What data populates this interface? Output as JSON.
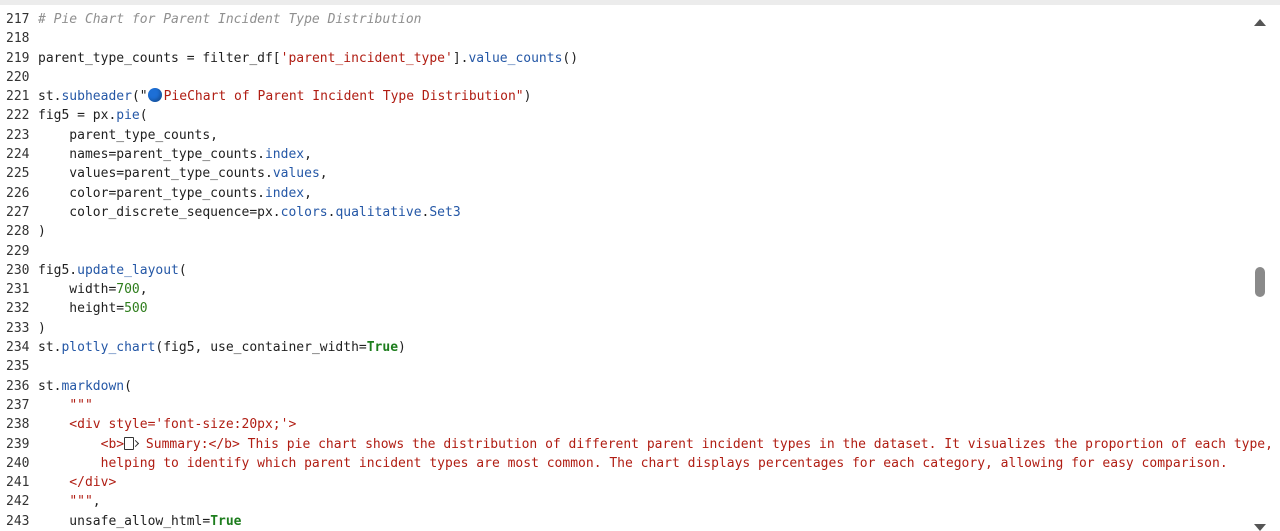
{
  "editor": {
    "lines": [
      {
        "n": "217",
        "parts": [
          {
            "t": "# Pie Chart for Parent Incident Type Distribution",
            "c": "comment"
          }
        ]
      },
      {
        "n": "218",
        "parts": []
      },
      {
        "n": "219",
        "parts": [
          {
            "t": "parent_type_counts = filter_df[",
            "c": ""
          },
          {
            "t": "'parent_incident_type'",
            "c": "str"
          },
          {
            "t": "].",
            "c": ""
          },
          {
            "t": "value_counts",
            "c": "attr"
          },
          {
            "t": "()",
            "c": ""
          }
        ]
      },
      {
        "n": "220",
        "parts": []
      },
      {
        "n": "221",
        "parts": [
          {
            "t": "st.",
            "c": ""
          },
          {
            "t": "subheader",
            "c": "attr"
          },
          {
            "t": "(\"",
            "c": ""
          },
          {
            "t": "",
            "c": "bluedot"
          },
          {
            "t": "PieChart of Parent Incident Type Distribution\"",
            "c": "str"
          },
          {
            "t": ")",
            "c": ""
          }
        ]
      },
      {
        "n": "222",
        "parts": [
          {
            "t": "fig5 = px.",
            "c": ""
          },
          {
            "t": "pie",
            "c": "attr"
          },
          {
            "t": "(",
            "c": ""
          }
        ]
      },
      {
        "n": "223",
        "parts": [
          {
            "t": "    parent_type_counts,",
            "c": ""
          }
        ]
      },
      {
        "n": "224",
        "parts": [
          {
            "t": "    names=parent_type_counts.",
            "c": ""
          },
          {
            "t": "index",
            "c": "attr"
          },
          {
            "t": ",",
            "c": ""
          }
        ]
      },
      {
        "n": "225",
        "parts": [
          {
            "t": "    values=parent_type_counts.",
            "c": ""
          },
          {
            "t": "values",
            "c": "attr"
          },
          {
            "t": ",",
            "c": ""
          }
        ]
      },
      {
        "n": "226",
        "parts": [
          {
            "t": "    color=parent_type_counts.",
            "c": ""
          },
          {
            "t": "index",
            "c": "attr"
          },
          {
            "t": ",",
            "c": ""
          }
        ]
      },
      {
        "n": "227",
        "parts": [
          {
            "t": "    color_discrete_sequence=px.",
            "c": ""
          },
          {
            "t": "colors",
            "c": "attr"
          },
          {
            "t": ".",
            "c": ""
          },
          {
            "t": "qualitative",
            "c": "attr"
          },
          {
            "t": ".",
            "c": ""
          },
          {
            "t": "Set3",
            "c": "attr"
          }
        ]
      },
      {
        "n": "228",
        "parts": [
          {
            "t": ")",
            "c": ""
          }
        ]
      },
      {
        "n": "229",
        "parts": []
      },
      {
        "n": "230",
        "parts": [
          {
            "t": "fig5.",
            "c": ""
          },
          {
            "t": "update_layout",
            "c": "attr"
          },
          {
            "t": "(",
            "c": ""
          }
        ]
      },
      {
        "n": "231",
        "parts": [
          {
            "t": "    width=",
            "c": ""
          },
          {
            "t": "700",
            "c": "num"
          },
          {
            "t": ",",
            "c": ""
          }
        ]
      },
      {
        "n": "232",
        "parts": [
          {
            "t": "    height=",
            "c": ""
          },
          {
            "t": "500",
            "c": "num"
          }
        ]
      },
      {
        "n": "233",
        "parts": [
          {
            "t": ")",
            "c": ""
          }
        ]
      },
      {
        "n": "234",
        "parts": [
          {
            "t": "st.",
            "c": ""
          },
          {
            "t": "plotly_chart",
            "c": "attr"
          },
          {
            "t": "(fig5, use_container_width=",
            "c": ""
          },
          {
            "t": "True",
            "c": "kw"
          },
          {
            "t": ")",
            "c": ""
          }
        ]
      },
      {
        "n": "235",
        "parts": []
      },
      {
        "n": "236",
        "parts": [
          {
            "t": "st.",
            "c": ""
          },
          {
            "t": "markdown",
            "c": "attr"
          },
          {
            "t": "(",
            "c": ""
          }
        ]
      },
      {
        "n": "237",
        "parts": [
          {
            "t": "    ",
            "c": ""
          },
          {
            "t": "\"\"\"",
            "c": "str"
          }
        ]
      },
      {
        "n": "238",
        "parts": [
          {
            "t": "    <div style='font-size:20px;'>",
            "c": "str"
          }
        ]
      },
      {
        "n": "239",
        "parts": [
          {
            "t": "        <b>",
            "c": "str"
          },
          {
            "t": "",
            "c": "pageicon"
          },
          {
            "t": " Summary:</b> This pie chart shows the distribution of different parent incident types in the dataset. It visualizes the proportion of each type,",
            "c": "str"
          }
        ]
      },
      {
        "n": "240",
        "parts": [
          {
            "t": "        helping to identify which parent incident types are most common. The chart displays percentages for each category, allowing for easy comparison.",
            "c": "str"
          }
        ]
      },
      {
        "n": "241",
        "parts": [
          {
            "t": "    </div>",
            "c": "str"
          }
        ]
      },
      {
        "n": "242",
        "parts": [
          {
            "t": "    ",
            "c": ""
          },
          {
            "t": "\"\"\"",
            "c": "str"
          },
          {
            "t": ",",
            "c": ""
          }
        ]
      },
      {
        "n": "243",
        "parts": [
          {
            "t": "    unsafe_allow_html=",
            "c": ""
          },
          {
            "t": "True",
            "c": "kw"
          }
        ]
      }
    ]
  }
}
